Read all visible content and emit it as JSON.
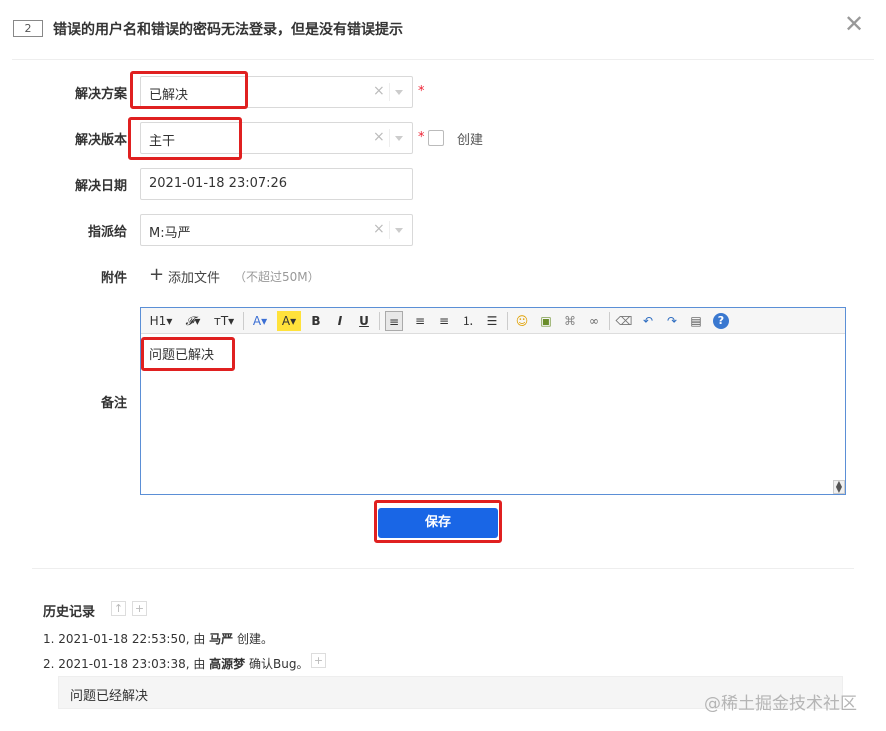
{
  "header": {
    "bug_id": "2",
    "title": "错误的用户名和错误的密码无法登录，但是没有错误提示",
    "close_glyph": "✕"
  },
  "form": {
    "resolution": {
      "label": "解决方案",
      "value": "已解决",
      "required_mark": "*"
    },
    "build": {
      "label": "解决版本",
      "value": "主干",
      "required_mark": "*",
      "create_label": "创建"
    },
    "date": {
      "label": "解决日期",
      "value": "2021-01-18 23:07:26"
    },
    "assign": {
      "label": "指派给",
      "value": "M:马严"
    },
    "attachment": {
      "label": "附件",
      "add_text": "添加文件",
      "hint": "（不超过50M）",
      "plus_glyph": "+"
    },
    "comment": {
      "label": "备注",
      "content": "问题已解决"
    },
    "clear_glyph": "×"
  },
  "toolbar": {
    "heading": "H1▾",
    "font_family": "𝓕▾",
    "font_size": "тT▾",
    "font_color": "A▾",
    "bg_color": "A▾",
    "bold": "B",
    "italic": "I",
    "underline": "U",
    "align_left": "≡",
    "align_center": "≡",
    "align_right": "≡",
    "ordered_list": "⒈",
    "unordered_list": "☰",
    "emoji": "☺",
    "image": "▣",
    "code": "⌘",
    "link": "∞",
    "eraser": "⌫",
    "undo": "↶",
    "redo": "↷",
    "paste": "▤",
    "help": "?"
  },
  "save_button": "保存",
  "history": {
    "title": "历史记录",
    "entries": [
      {
        "prefix": "1. 2021-01-18 22:53:50, 由 ",
        "user": "马严",
        "action": " 创建。"
      },
      {
        "prefix": "2. 2021-01-18 23:03:38, 由 ",
        "user": "高源梦",
        "action": " 确认Bug。"
      }
    ],
    "comment": "问题已经解决"
  },
  "watermark": "@稀土掘金技术社区"
}
